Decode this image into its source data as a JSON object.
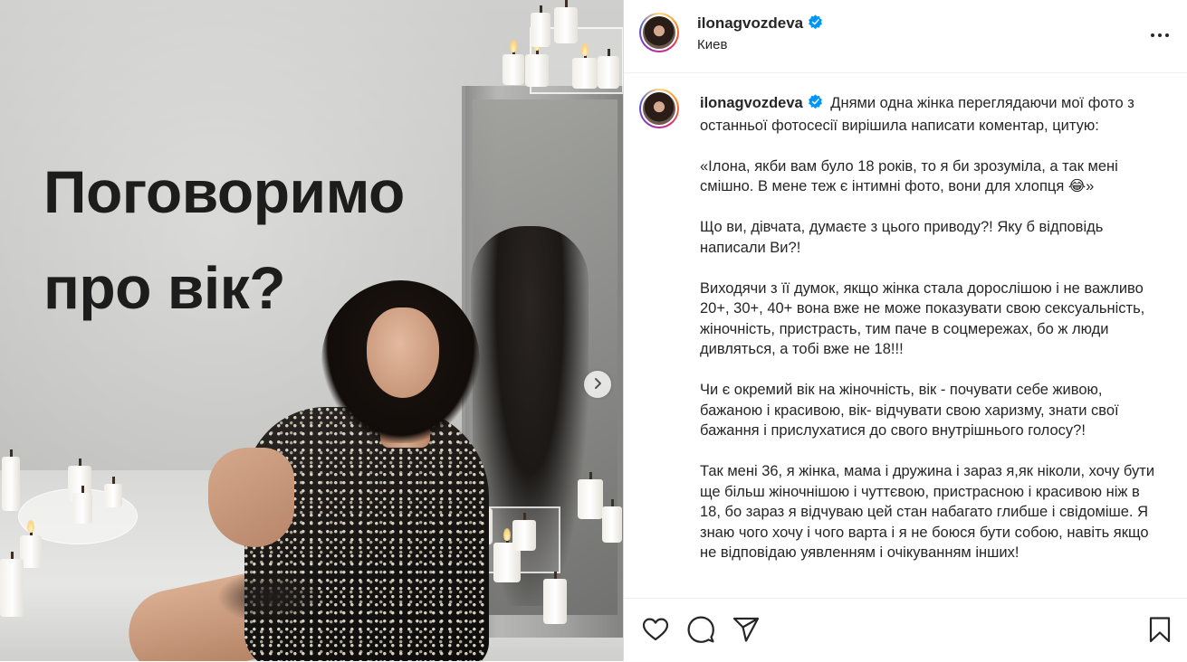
{
  "media": {
    "overlay_text": "Поговоримо\nпро вік?",
    "next_icon": "chevron-right-icon"
  },
  "header": {
    "username": "ilonagvozdeva",
    "location": "Киев",
    "more_icon": "more-horizontal-icon",
    "verified_color": "#0095f6"
  },
  "caption": {
    "username": "ilonagvozdeva",
    "first_paragraph": "Днями одна жінка переглядаючи мої фото з останньої фотосесії вирішила написати коментар, цитую:",
    "paragraphs": [
      "«Ілона, якби вам було 18 років, то я би зрозуміла, а так мені смішно. В мене теж є інтимні фото, вони для хлопця 😂»",
      "Що ви, дівчата, думаєте з цього приводу?! Яку б відповідь написали Ви?!",
      "Виходячи з її думок, якщо жінка стала дорослішою і не важливо 20+, 30+, 40+ вона вже не може показувати свою сексуальність, жіночність, пристрасть, тим паче в соцмережах, бо ж люди дивляться, а тобі вже не 18!!!",
      "Чи є окремий вік на жіночність, вік - почувати себе живою, бажаною і красивою, вік- відчувати свою харизму, знати свої бажання і прислухатися до свого внутрішнього голосу?!",
      "Так мені 36, я жінка, мама і дружина і зараз я,як ніколи, хочу бути ще більш жіночнішою і чуттєвою, пристрасною і красивою ніж в 18, бо зараз я відчуваю цей стан набагато глибше і свідоміше. Я знаю чого хочу і чого варта і я не боюся бути собою, навіть якщо не відповідаю уявленням і очікуванням інших!"
    ]
  },
  "actions": {
    "like_icon": "heart-icon",
    "comment_icon": "comment-icon",
    "share_icon": "send-icon",
    "save_icon": "bookmark-icon"
  }
}
